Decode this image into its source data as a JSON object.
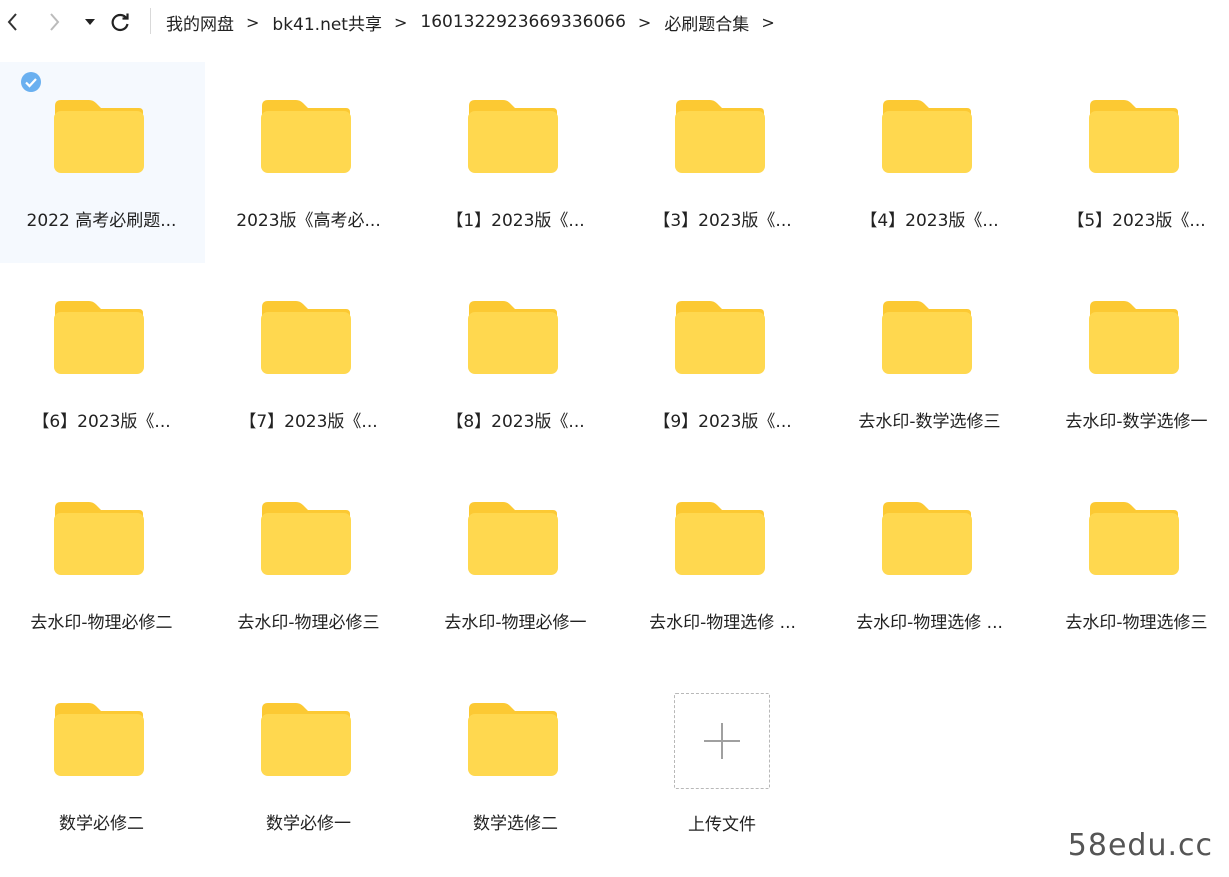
{
  "toolbar": {
    "back_icon": "chevron-left-icon",
    "forward_icon": "chevron-right-icon",
    "dropdown_icon": "caret-down-icon",
    "refresh_icon": "refresh-icon"
  },
  "breadcrumb": {
    "separator": ">",
    "items": [
      {
        "label": "我的网盘"
      },
      {
        "label": "bk41.net共享"
      },
      {
        "label": "1601322923669336066"
      },
      {
        "label": "必刷题合集"
      }
    ]
  },
  "folders": [
    {
      "label": "2022 高考必刷题...",
      "selected": true
    },
    {
      "label": "2023版《高考必..."
    },
    {
      "label": "【1】2023版《..."
    },
    {
      "label": "【3】2023版《..."
    },
    {
      "label": "【4】2023版《..."
    },
    {
      "label": "【5】2023版《..."
    },
    {
      "label": "【6】2023版《..."
    },
    {
      "label": "【7】2023版《..."
    },
    {
      "label": "【8】2023版《..."
    },
    {
      "label": "【9】2023版《..."
    },
    {
      "label": "去水印-数学选修三"
    },
    {
      "label": "去水印-数学选修一"
    },
    {
      "label": "去水印-物理必修二"
    },
    {
      "label": "去水印-物理必修三"
    },
    {
      "label": "去水印-物理必修一"
    },
    {
      "label": "去水印-物理选修 ..."
    },
    {
      "label": "去水印-物理选修 ..."
    },
    {
      "label": "去水印-物理选修三"
    },
    {
      "label": "数学必修二"
    },
    {
      "label": "数学必修一"
    },
    {
      "label": "数学选修二"
    }
  ],
  "upload": {
    "label": "上传文件",
    "icon": "plus-icon"
  },
  "watermark": "58edu.cc",
  "colors": {
    "folder": "#ffd84f",
    "folder_tab": "#fcc933",
    "check": "#6ab0f0",
    "selected_bg": "#f5f9fe"
  }
}
